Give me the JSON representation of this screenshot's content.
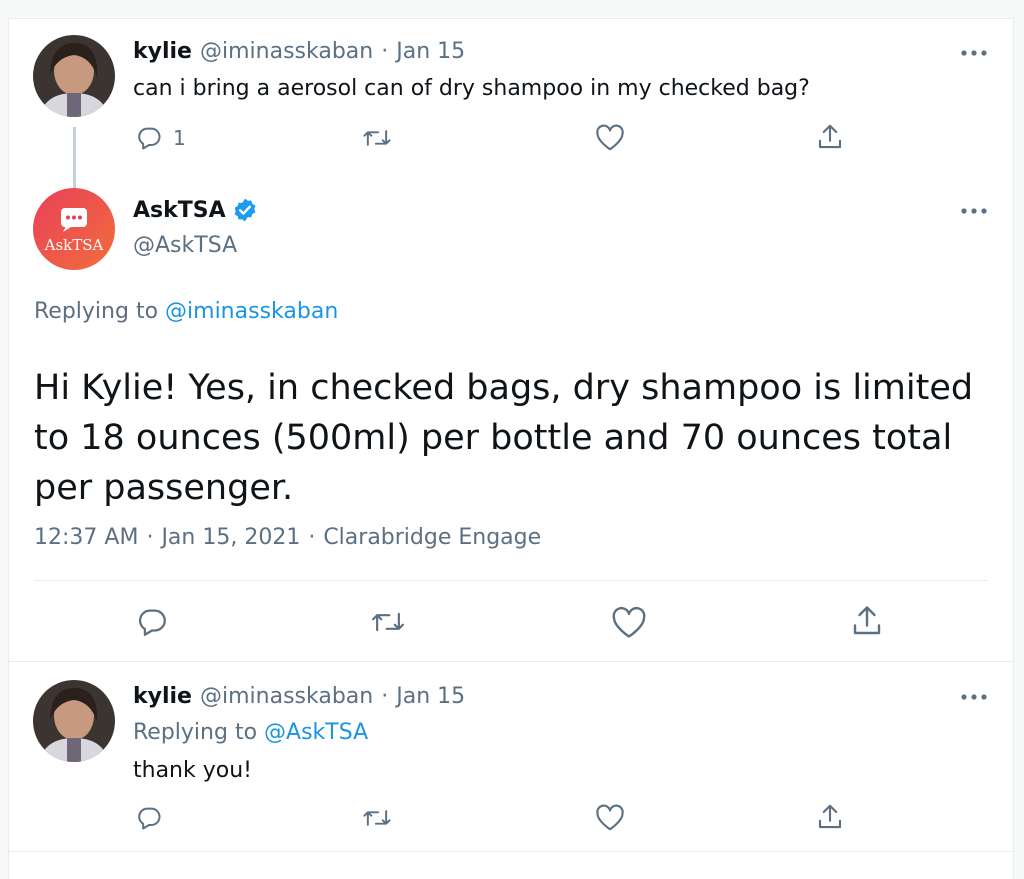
{
  "tweets": [
    {
      "name": "kylie",
      "handle": "@iminasskaban",
      "separator": "·",
      "date": "Jan 15",
      "text": "can i bring a aerosol can of dry shampoo in my checked bag?",
      "reply_count": "1"
    },
    {
      "name": "AskTSA",
      "handle": "@AskTSA",
      "verified": true,
      "replying_prefix": "Replying to",
      "replying_handle": "@iminasskaban",
      "text": "Hi Kylie! Yes, in checked bags, dry shampoo is limited to 18 ounces (500ml) per bottle and 70 ounces total per passenger.",
      "time": "12:37 AM",
      "separator": "·",
      "full_date": "Jan 15, 2021",
      "source": "Clarabridge Engage",
      "avatar_label": "AskTSA"
    },
    {
      "name": "kylie",
      "handle": "@iminasskaban",
      "separator": "·",
      "date": "Jan 15",
      "replying_prefix": "Replying to",
      "replying_handle": "@AskTSA",
      "text": "thank you!"
    }
  ],
  "icons": [
    "reply-icon",
    "retweet-icon",
    "like-icon",
    "share-icon",
    "more-icon",
    "verified-badge-icon"
  ],
  "colors": {
    "link": "#1b95e0",
    "muted": "#5b7083",
    "verified": "#1d9bf0",
    "asktsa_gradient_start": "#e8405a",
    "asktsa_gradient_end": "#f36d3b"
  }
}
